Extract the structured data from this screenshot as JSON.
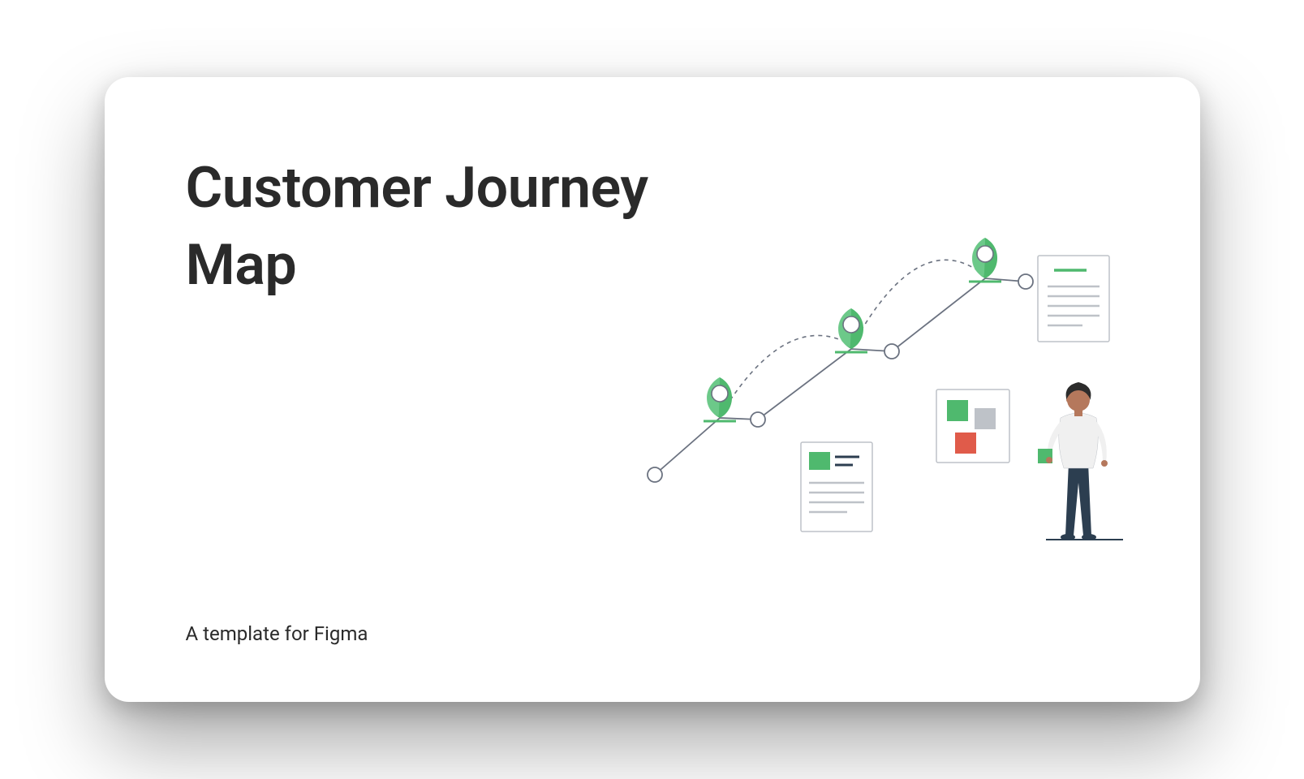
{
  "title": "Customer Journey Map",
  "subtitle": "A template for Figma",
  "colors": {
    "green": "#4FB96E",
    "green_light": "#6EC98A",
    "red": "#E05B4A",
    "grey": "#BEC2C8",
    "dark_navy": "#2C3E50",
    "skin": "#B5785C",
    "hair": "#2C2C2C",
    "shirt": "#F0F0F0",
    "line": "#6B7280"
  }
}
